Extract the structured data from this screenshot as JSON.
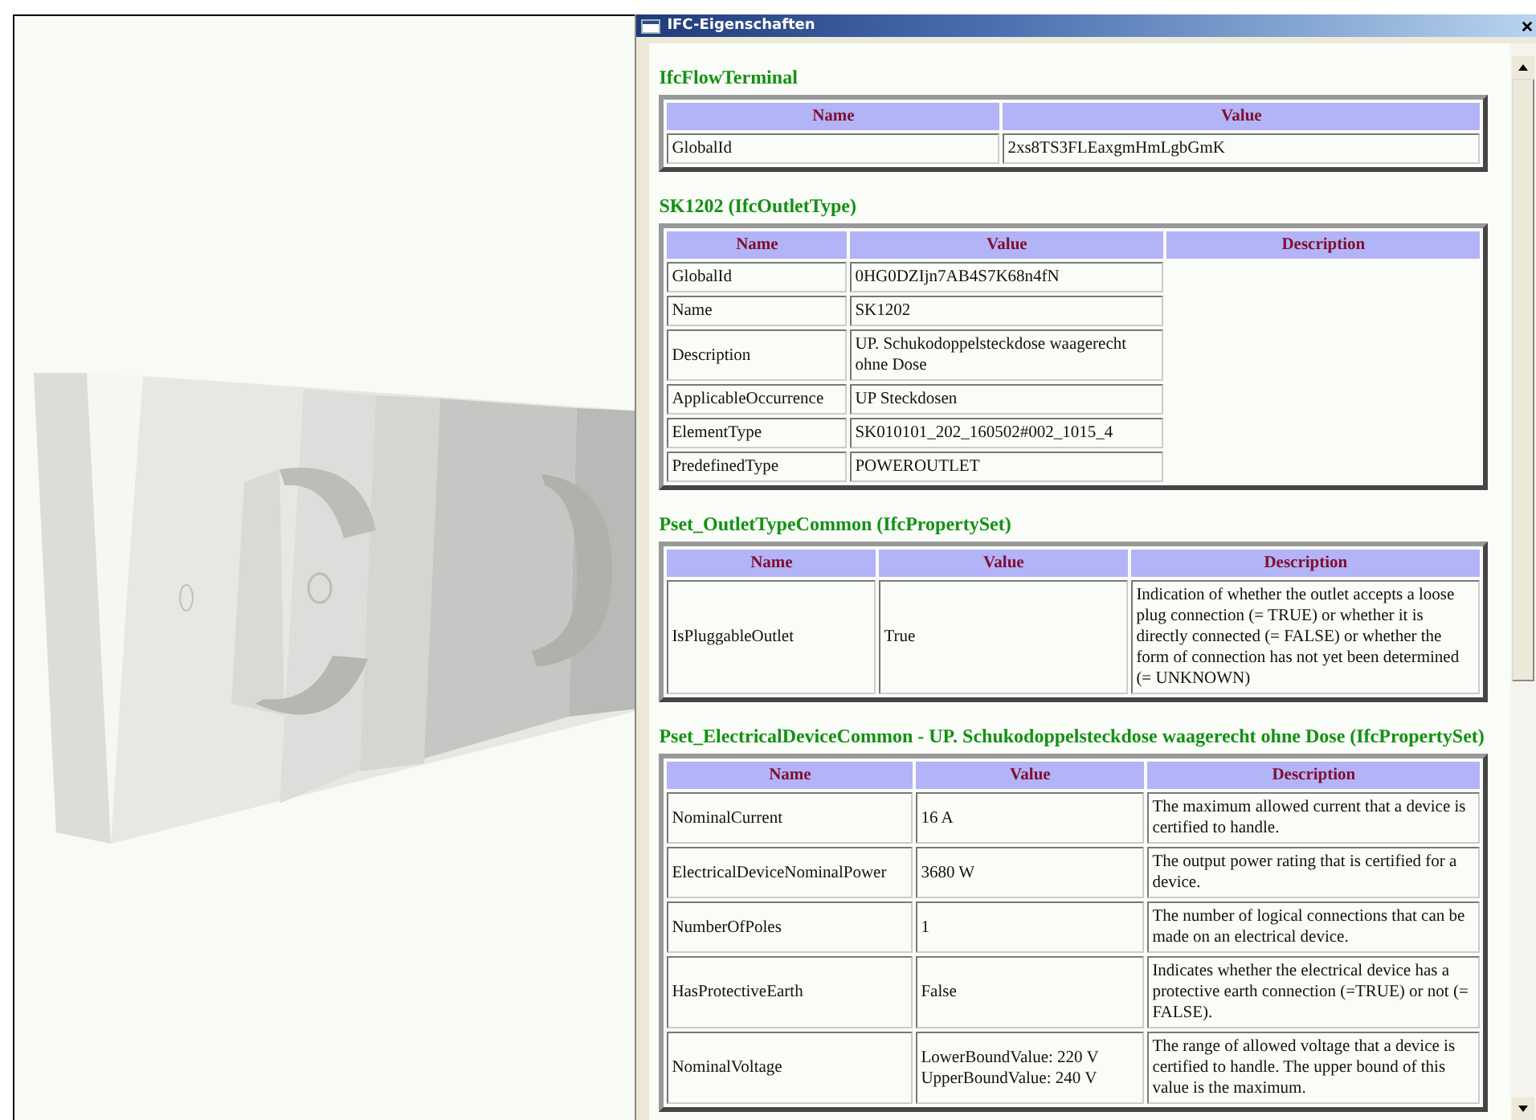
{
  "window": {
    "title": "IFC-Eigenschaften"
  },
  "sections": [
    {
      "title": "IfcFlowTerminal",
      "columns": [
        "Name",
        "Value"
      ],
      "rows": [
        {
          "cells": [
            "GlobalId",
            "2xs8TS3FLEaxgmHmLgbGmK"
          ]
        }
      ]
    },
    {
      "title": "SK1202 (IfcOutletType)",
      "columns": [
        "Name",
        "Value",
        "Description"
      ],
      "rows": [
        {
          "cells": [
            "GlobalId",
            "0HG0DZIjn7AB4S7K68n4fN"
          ]
        },
        {
          "cells": [
            "Name",
            "SK1202"
          ]
        },
        {
          "cells": [
            "Description",
            "UP. Schukodoppelsteckdose waagerecht ohne Dose"
          ]
        },
        {
          "cells": [
            "ApplicableOccurrence",
            "UP Steckdosen"
          ]
        },
        {
          "cells": [
            "ElementType",
            "SK010101_202_160502#002_1015_4"
          ]
        },
        {
          "cells": [
            "PredefinedType",
            "POWEROUTLET"
          ]
        }
      ]
    },
    {
      "title": "Pset_OutletTypeCommon (IfcPropertySet)",
      "columns": [
        "Name",
        "Value",
        "Description"
      ],
      "rows": [
        {
          "cells": [
            "IsPluggableOutlet",
            "True",
            "Indication of whether the outlet accepts a loose plug connection (= TRUE) or whether it is directly connected (= FALSE) or whether the form of connection has not yet been determined (= UNKNOWN)"
          ]
        }
      ]
    },
    {
      "title": "Pset_ElectricalDeviceCommon - UP. Schukodoppelsteckdose waagerecht ohne Dose (IfcPropertySet)",
      "columns": [
        "Name",
        "Value",
        "Description"
      ],
      "rows": [
        {
          "cells": [
            "NominalCurrent",
            "16 A",
            "The maximum allowed current that a device is certified to handle."
          ]
        },
        {
          "cells": [
            "ElectricalDeviceNominalPower",
            "3680 W",
            "The output power rating that is certified for a device."
          ]
        },
        {
          "cells": [
            "NumberOfPoles",
            "1",
            "The number of logical connections that can be made on an electrical device."
          ]
        },
        {
          "cells": [
            "HasProtectiveEarth",
            "False",
            "Indicates whether the electrical device has a protective earth connection (=TRUE) or not (= FALSE)."
          ]
        },
        {
          "cells": [
            "NominalVoltage",
            "LowerBoundValue: 220 V\nUpperBoundValue: 240 V",
            "The range of allowed voltage that a device is certified to handle. The upper bound of this value is the maximum."
          ]
        }
      ]
    }
  ]
}
